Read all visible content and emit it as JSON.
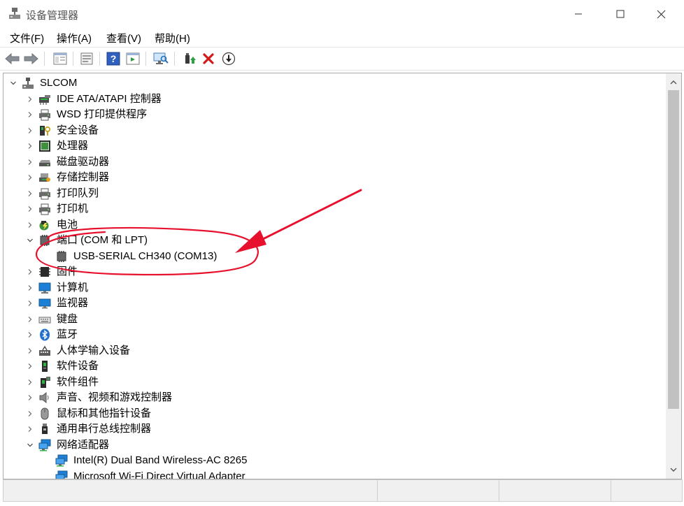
{
  "window": {
    "title": "设备管理器"
  },
  "menu": [
    {
      "label": "文件(F)"
    },
    {
      "label": "操作(A)"
    },
    {
      "label": "查看(V)"
    },
    {
      "label": "帮助(H)"
    }
  ],
  "tree": {
    "root": "SLCOM",
    "items": [
      {
        "label": "IDE ATA/ATAPI 控制器",
        "icon": "ide-controller-icon"
      },
      {
        "label": "WSD 打印提供程序",
        "icon": "printer-icon"
      },
      {
        "label": "安全设备",
        "icon": "security-device-icon"
      },
      {
        "label": "处理器",
        "icon": "processor-icon"
      },
      {
        "label": "磁盘驱动器",
        "icon": "disk-drive-icon"
      },
      {
        "label": "存储控制器",
        "icon": "storage-controller-icon"
      },
      {
        "label": "打印队列",
        "icon": "printer-icon"
      },
      {
        "label": "打印机",
        "icon": "printer-icon"
      },
      {
        "label": "电池",
        "icon": "battery-icon"
      },
      {
        "label": "端口 (COM 和 LPT)",
        "icon": "port-icon",
        "expanded": true,
        "children": [
          {
            "label": "USB-SERIAL CH340 (COM13)",
            "icon": "port-icon"
          }
        ]
      },
      {
        "label": "固件",
        "icon": "firmware-icon"
      },
      {
        "label": "计算机",
        "icon": "computer-icon"
      },
      {
        "label": "监视器",
        "icon": "monitor-icon"
      },
      {
        "label": "键盘",
        "icon": "keyboard-icon"
      },
      {
        "label": "蓝牙",
        "icon": "bluetooth-icon"
      },
      {
        "label": "人体学输入设备",
        "icon": "hid-icon"
      },
      {
        "label": "软件设备",
        "icon": "software-device-icon"
      },
      {
        "label": "软件组件",
        "icon": "software-component-icon"
      },
      {
        "label": "声音、视频和游戏控制器",
        "icon": "speaker-icon"
      },
      {
        "label": "鼠标和其他指针设备",
        "icon": "mouse-icon"
      },
      {
        "label": "通用串行总线控制器",
        "icon": "usb-icon"
      },
      {
        "label": "网络适配器",
        "icon": "network-adapter-icon",
        "expanded": true,
        "children": [
          {
            "label": "Intel(R) Dual Band Wireless-AC 8265",
            "icon": "network-adapter-icon"
          },
          {
            "label": "Microsoft Wi-Fi Direct Virtual Adapter",
            "icon": "network-adapter-icon"
          }
        ]
      }
    ]
  },
  "annotation": {
    "color": "#e8112d"
  }
}
